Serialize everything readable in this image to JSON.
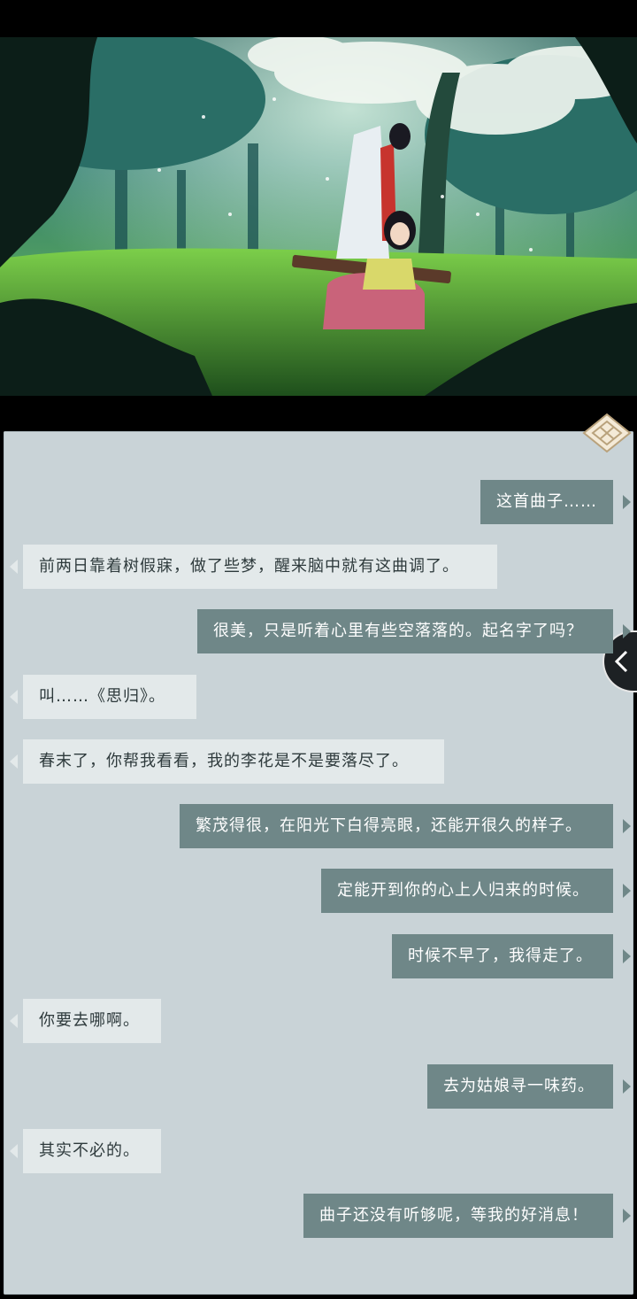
{
  "scene": {
    "description_icon": "illustration-two-characters-under-blossom-tree"
  },
  "chat": {
    "messages": [
      {
        "side": "right",
        "text": "这首曲子……"
      },
      {
        "side": "left",
        "text": "前两日靠着树假寐，做了些梦，醒来脑中就有这曲调了。"
      },
      {
        "side": "right",
        "text": "很美，只是听着心里有些空落落的。起名字了吗？"
      },
      {
        "side": "left",
        "text": "叫……《思归》。"
      },
      {
        "side": "left",
        "text": "春末了，你帮我看看，我的李花是不是要落尽了。"
      },
      {
        "side": "right",
        "text": "繁茂得很，在阳光下白得亮眼，还能开很久的样子。"
      },
      {
        "side": "right",
        "text": "定能开到你的心上人归来的时候。"
      },
      {
        "side": "right",
        "text": "时候不早了，我得走了。"
      },
      {
        "side": "left",
        "text": "你要去哪啊。"
      },
      {
        "side": "right",
        "text": "去为姑娘寻一味药。"
      },
      {
        "side": "left",
        "text": "其实不必的。"
      },
      {
        "side": "right",
        "text": "曲子还没有听够呢，等我的好消息！"
      }
    ]
  },
  "colors": {
    "player_bubble": "#6f8788",
    "npc_bubble": "#e3e9ea",
    "panel_bg": "#c9d3d7"
  },
  "icons": {
    "corner": "diamond-emblem-icon",
    "back": "chevron-left-icon"
  }
}
